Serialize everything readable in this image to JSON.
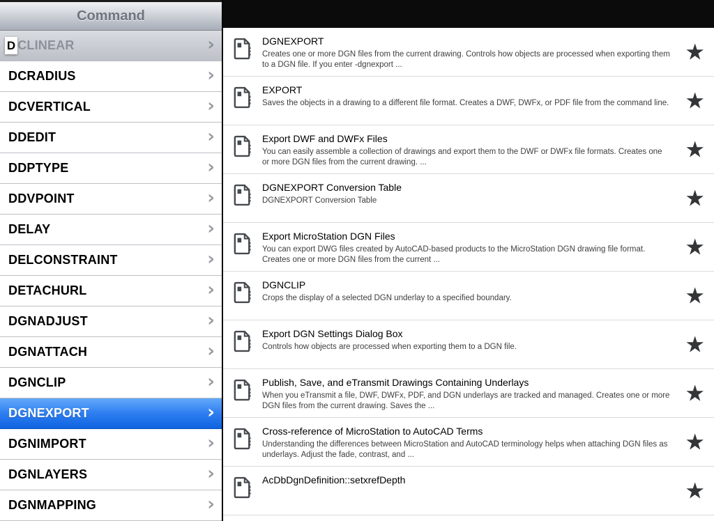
{
  "colors": {
    "selection_blue": "#2e7ef1",
    "topbar_black": "#0b0b0b",
    "star_gray": "#343537"
  },
  "sidebar": {
    "header": "Command",
    "index_letter": "D",
    "items": [
      {
        "label": "DCLINEAR",
        "state": "dimmed"
      },
      {
        "label": "DCRADIUS",
        "state": "normal"
      },
      {
        "label": "DCVERTICAL",
        "state": "normal"
      },
      {
        "label": "DDEDIT",
        "state": "normal"
      },
      {
        "label": "DDPTYPE",
        "state": "normal"
      },
      {
        "label": "DDVPOINT",
        "state": "normal"
      },
      {
        "label": "DELAY",
        "state": "normal"
      },
      {
        "label": "DELCONSTRAINT",
        "state": "normal"
      },
      {
        "label": "DETACHURL",
        "state": "normal"
      },
      {
        "label": "DGNADJUST",
        "state": "normal"
      },
      {
        "label": "DGNATTACH",
        "state": "normal"
      },
      {
        "label": "DGNCLIP",
        "state": "normal"
      },
      {
        "label": "DGNEXPORT",
        "state": "selected"
      },
      {
        "label": "DGNIMPORT",
        "state": "normal"
      },
      {
        "label": "DGNLAYERS",
        "state": "normal"
      },
      {
        "label": "DGNMAPPING",
        "state": "normal"
      }
    ]
  },
  "results": {
    "items": [
      {
        "title": "DGNEXPORT",
        "description": "Creates one or more DGN files from the current drawing. Controls how objects are processed when exporting them to a DGN file. If you enter -dgnexport  ..."
      },
      {
        "title": "EXPORT",
        "description": "Saves the objects in a drawing to a different file format. Creates a DWF, DWFx, or PDF file from the command line."
      },
      {
        "title": "Export DWF and DWFx Files",
        "description": "You can easily assemble a collection of drawings and export them to the DWF or DWFx file formats. Creates one or more DGN files from the current drawing.  ..."
      },
      {
        "title": "DGNEXPORT Conversion Table",
        "description": "DGNEXPORT Conversion Table"
      },
      {
        "title": "Export MicroStation DGN Files",
        "description": "You can export DWG files created by AutoCAD-based products to the MicroStation DGN drawing file format. Creates one or more DGN files from the current  ..."
      },
      {
        "title": "DGNCLIP",
        "description": "Crops the display of a selected DGN underlay to a specified boundary."
      },
      {
        "title": "Export DGN Settings Dialog Box",
        "description": "Controls how objects are processed when exporting them to a DGN file."
      },
      {
        "title": "Publish, Save, and eTransmit Drawings Containing Underlays",
        "description": "When you eTransmit a file, DWF, DWFx, PDF, and DGN underlays are tracked and managed. Creates one or more DGN files from the current drawing. Saves the  ..."
      },
      {
        "title": "Cross-reference of MicroStation to AutoCAD Terms",
        "description": "Understanding the differences between MicroStation and AutoCAD terminology helps when attaching DGN files as underlays. Adjust the fade, contrast, and  ..."
      },
      {
        "title": "AcDbDgnDefinition::setxrefDepth",
        "description": ""
      }
    ]
  }
}
